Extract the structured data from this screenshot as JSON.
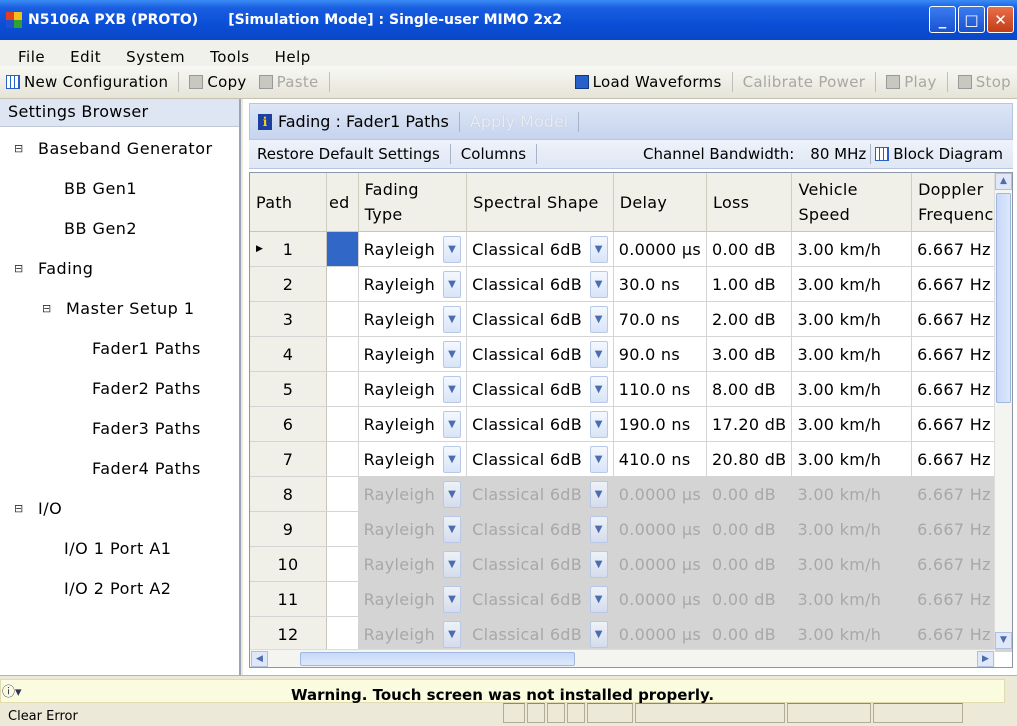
{
  "window": {
    "app_title": "N5106A PXB (PROTO)",
    "mode_title": "[Simulation Mode] : Single-user MIMO 2x2",
    "minimize": "_",
    "maximize": "□",
    "close": "✕"
  },
  "menu": [
    "File",
    "Edit",
    "System",
    "Tools",
    "Help"
  ],
  "toolbar": {
    "new_config": "New Configuration",
    "copy": "Copy",
    "paste": "Paste",
    "load_waveforms": "Load Waveforms",
    "calibrate_power": "Calibrate Power",
    "play": "Play",
    "stop": "Stop"
  },
  "browser": {
    "title": "Settings Browser",
    "items": [
      {
        "label": "Baseband Generator",
        "toggle": "⊟"
      },
      {
        "label": "BB Gen1",
        "toggle": ""
      },
      {
        "label": "BB Gen2",
        "toggle": ""
      },
      {
        "label": "Fading",
        "toggle": "⊟"
      },
      {
        "label": "Master Setup 1",
        "toggle": "⊟"
      },
      {
        "label": "Fader1 Paths",
        "toggle": ""
      },
      {
        "label": "Fader2 Paths",
        "toggle": ""
      },
      {
        "label": "Fader3 Paths",
        "toggle": ""
      },
      {
        "label": "Fader4 Paths",
        "toggle": ""
      },
      {
        "label": "I/O",
        "toggle": "⊟"
      },
      {
        "label": "I/O 1 Port A1",
        "toggle": ""
      },
      {
        "label": "I/O 2 Port A2",
        "toggle": ""
      }
    ]
  },
  "panel": {
    "title": "Fading : Fader1 Paths",
    "apply_model": "Apply Model",
    "restore_defaults": "Restore Default Settings",
    "columns": "Columns",
    "channel_bandwidth_label": "Channel Bandwidth:",
    "channel_bandwidth_value": "80 MHz",
    "block_diagram": "Block Diagram"
  },
  "grid": {
    "headers": {
      "path": "Path",
      "enabled": "ed",
      "fading_type": "Fading Type",
      "spectral_shape": "Spectral Shape",
      "delay": "Delay",
      "loss": "Loss",
      "vehicle_speed": "Vehicle Speed",
      "doppler": "Doppler Frequency"
    },
    "rows": [
      {
        "path": "1",
        "fading": "Rayleigh",
        "shape": "Classical 6dB",
        "delay": "0.0000 µs",
        "loss": "0.00 dB",
        "speed": "3.00 km/h",
        "doppler": "6.667 Hz"
      },
      {
        "path": "2",
        "fading": "Rayleigh",
        "shape": "Classical 6dB",
        "delay": "30.0 ns",
        "loss": "1.00 dB",
        "speed": "3.00 km/h",
        "doppler": "6.667 Hz"
      },
      {
        "path": "3",
        "fading": "Rayleigh",
        "shape": "Classical 6dB",
        "delay": "70.0 ns",
        "loss": "2.00 dB",
        "speed": "3.00 km/h",
        "doppler": "6.667 Hz"
      },
      {
        "path": "4",
        "fading": "Rayleigh",
        "shape": "Classical 6dB",
        "delay": "90.0 ns",
        "loss": "3.00 dB",
        "speed": "3.00 km/h",
        "doppler": "6.667 Hz"
      },
      {
        "path": "5",
        "fading": "Rayleigh",
        "shape": "Classical 6dB",
        "delay": "110.0 ns",
        "loss": "8.00 dB",
        "speed": "3.00 km/h",
        "doppler": "6.667 Hz"
      },
      {
        "path": "6",
        "fading": "Rayleigh",
        "shape": "Classical 6dB",
        "delay": "190.0 ns",
        "loss": "17.20 dB",
        "speed": "3.00 km/h",
        "doppler": "6.667 Hz"
      },
      {
        "path": "7",
        "fading": "Rayleigh",
        "shape": "Classical 6dB",
        "delay": "410.0 ns",
        "loss": "20.80 dB",
        "speed": "3.00 km/h",
        "doppler": "6.667 Hz"
      },
      {
        "path": "8",
        "fading": "Rayleigh",
        "shape": "Classical 6dB",
        "delay": "0.0000 µs",
        "loss": "0.00 dB",
        "speed": "3.00 km/h",
        "doppler": "6.667 Hz",
        "inactive": true
      },
      {
        "path": "9",
        "fading": "Rayleigh",
        "shape": "Classical 6dB",
        "delay": "0.0000 µs",
        "loss": "0.00 dB",
        "speed": "3.00 km/h",
        "doppler": "6.667 Hz",
        "inactive": true
      },
      {
        "path": "10",
        "fading": "Rayleigh",
        "shape": "Classical 6dB",
        "delay": "0.0000 µs",
        "loss": "0.00 dB",
        "speed": "3.00 km/h",
        "doppler": "6.667 Hz",
        "inactive": true
      },
      {
        "path": "11",
        "fading": "Rayleigh",
        "shape": "Classical 6dB",
        "delay": "0.0000 µs",
        "loss": "0.00 dB",
        "speed": "3.00 km/h",
        "doppler": "6.667 Hz",
        "inactive": true
      },
      {
        "path": "12",
        "fading": "Rayleigh",
        "shape": "Classical 6dB",
        "delay": "0.0000 µs",
        "loss": "0.00 dB",
        "speed": "3.00 km/h",
        "doppler": "6.667 Hz",
        "inactive": true
      }
    ]
  },
  "status": {
    "warning": "Warning. Touch screen was not installed properly.",
    "clear_error": "Clear Error",
    "info_icon": "ⓘ▾"
  },
  "colors": {
    "selection": "#3168c8",
    "title_bar": "#0a4fd6",
    "inactive_row": "#d4d4d4"
  }
}
